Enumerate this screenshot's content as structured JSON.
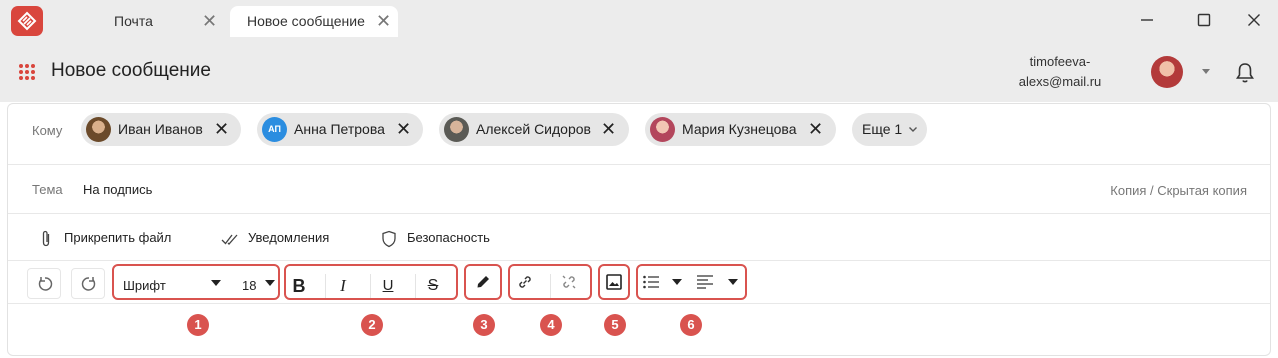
{
  "tabs": [
    {
      "label": "Почта",
      "close": "✕"
    },
    {
      "label": "Новое сообщение",
      "close": "✕"
    }
  ],
  "header": {
    "title": "Новое сообщение",
    "user_email_line1": "timofeeva-",
    "user_email_line2": "alexs@mail.ru"
  },
  "compose": {
    "to_label": "Кому",
    "recipients": [
      {
        "name": "Иван Иванов",
        "avatar": "photo"
      },
      {
        "name": "Анна Петрова",
        "avatar": "initials",
        "initials": "АП"
      },
      {
        "name": "Алексей Сидоров",
        "avatar": "photo"
      },
      {
        "name": "Мария Кузнецова",
        "avatar": "photo"
      }
    ],
    "more_label": "Еще 1",
    "subject_label": "Тема",
    "subject_value": "На подпись",
    "cc_label": "Копия / Скрытая копия"
  },
  "actions": {
    "attach": "Прикрепить файл",
    "notifications": "Уведомления",
    "security": "Безопасность"
  },
  "toolbar": {
    "font_label": "Шрифт",
    "font_size": "18",
    "bold": "B",
    "italic": "I",
    "underline": "U",
    "strike": "S"
  },
  "badges": [
    "1",
    "2",
    "3",
    "4",
    "5",
    "6"
  ],
  "colors": {
    "accent": "#d9534f",
    "brand": "#d9463d",
    "chrome": "#ececec",
    "chip": "#e6e6e6",
    "initials_avatar": "#2b8de0"
  }
}
